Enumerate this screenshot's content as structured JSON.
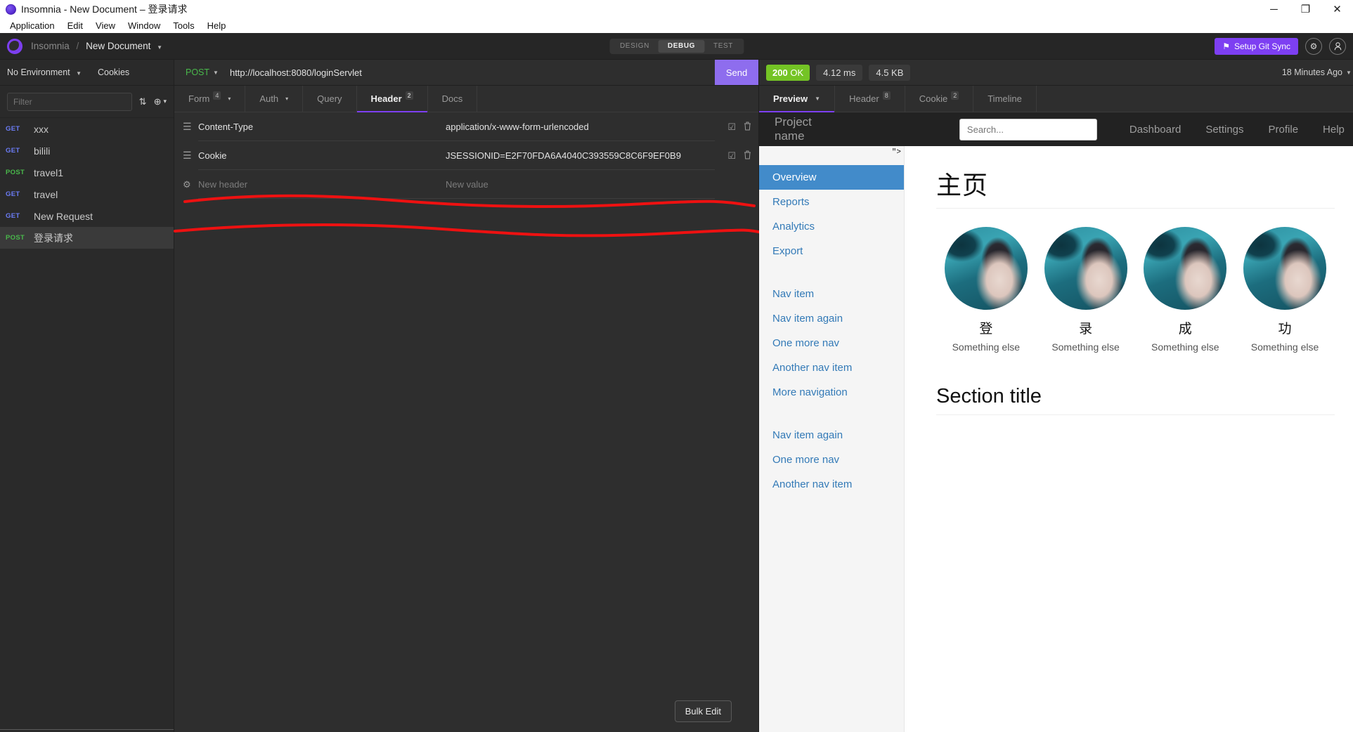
{
  "window": {
    "title": "Insomnia - New Document – 登录请求",
    "minimize": "─",
    "maximize": "❐",
    "close": "✕"
  },
  "menubar": [
    "Application",
    "Edit",
    "View",
    "Window",
    "Tools",
    "Help"
  ],
  "appheader": {
    "app_name": "Insomnia",
    "separator": "/",
    "document": "New Document",
    "caret": "▼",
    "modes": [
      {
        "label": "DESIGN",
        "active": false
      },
      {
        "label": "DEBUG",
        "active": true
      },
      {
        "label": "TEST",
        "active": false
      }
    ],
    "git_sync": "Setup Git Sync",
    "git_icon": "⚑",
    "settings_icon": "⚙",
    "account_icon": "👤"
  },
  "sidebar": {
    "environment": "No Environment",
    "environment_caret": "▼",
    "cookies": "Cookies",
    "filter_placeholder": "Filter",
    "sort_icon": "⇅",
    "plus_icon": "⊕",
    "plus_caret": "▾",
    "requests": [
      {
        "method": "GET",
        "name": "xxx",
        "active": false
      },
      {
        "method": "GET",
        "name": "bilili",
        "active": false
      },
      {
        "method": "POST",
        "name": "travel1",
        "active": false
      },
      {
        "method": "GET",
        "name": "travel",
        "active": false
      },
      {
        "method": "GET",
        "name": "New Request",
        "active": false
      },
      {
        "method": "POST",
        "name": "登录请求",
        "active": true
      }
    ]
  },
  "request": {
    "method": "POST",
    "method_caret": "▼",
    "url": "http://localhost:8080/loginServlet",
    "send_label": "Send",
    "tabs": [
      {
        "label": "Form",
        "badge": "4",
        "caret": "▾",
        "active": false
      },
      {
        "label": "Auth",
        "badge": "",
        "caret": "▾",
        "active": false
      },
      {
        "label": "Query",
        "badge": "",
        "caret": "",
        "active": false
      },
      {
        "label": "Header",
        "badge": "2",
        "caret": "",
        "active": true
      },
      {
        "label": "Docs",
        "badge": "",
        "caret": "",
        "active": false
      }
    ],
    "headers": [
      {
        "name": "Content-Type",
        "value": "application/x-www-form-urlencoded"
      },
      {
        "name": "Cookie",
        "value": "JSESSIONID=E2F70FDA6A4040C393559C8C6F9EF0B9"
      }
    ],
    "new_header_placeholder": "New header",
    "new_value_placeholder": "New value",
    "drag_icon": "☰",
    "gear_icon": "⚙",
    "check_icon": "☑",
    "trash_icon": "🗑",
    "bulk_edit": "Bulk Edit"
  },
  "response": {
    "status_code": "200",
    "status_text": "OK",
    "time": "4.12 ms",
    "size": "4.5 KB",
    "history": "18 Minutes Ago",
    "history_caret": "▼",
    "tabs": [
      {
        "label": "Preview",
        "badge": "",
        "caret": "▼",
        "active": true
      },
      {
        "label": "Header",
        "badge": "8",
        "caret": "",
        "active": false
      },
      {
        "label": "Cookie",
        "badge": "2",
        "caret": "",
        "active": false
      },
      {
        "label": "Timeline",
        "badge": "",
        "caret": "",
        "active": false
      }
    ]
  },
  "preview_page": {
    "brand": "Project name",
    "search_placeholder": "Search...",
    "nav_links": [
      "Dashboard",
      "Settings",
      "Profile",
      "Help"
    ],
    "artifact": "\">",
    "side_nav_group1": [
      {
        "label": "Overview",
        "active": true
      },
      {
        "label": "Reports",
        "active": false
      },
      {
        "label": "Analytics",
        "active": false
      },
      {
        "label": "Export",
        "active": false
      }
    ],
    "side_nav_group2": [
      {
        "label": "Nav item",
        "active": false
      },
      {
        "label": "Nav item again",
        "active": false
      },
      {
        "label": "One more nav",
        "active": false
      },
      {
        "label": "Another nav item",
        "active": false
      },
      {
        "label": "More navigation",
        "active": false
      }
    ],
    "side_nav_group3": [
      {
        "label": "Nav item again",
        "active": false
      },
      {
        "label": "One more nav",
        "active": false
      },
      {
        "label": "Another nav item",
        "active": false
      }
    ],
    "page_title": "主页",
    "cards": [
      {
        "heading": "登",
        "caption": "Something else"
      },
      {
        "heading": "录",
        "caption": "Something else"
      },
      {
        "heading": "成",
        "caption": "Something else"
      },
      {
        "heading": "功",
        "caption": "Something else"
      }
    ],
    "section_title": "Section title"
  },
  "colors": {
    "accent_purple": "#7d3ff2",
    "status_green": "#74c425",
    "nav_active_blue": "#428bca",
    "link_blue": "#337ab7",
    "annotation_red": "#ee1111"
  }
}
